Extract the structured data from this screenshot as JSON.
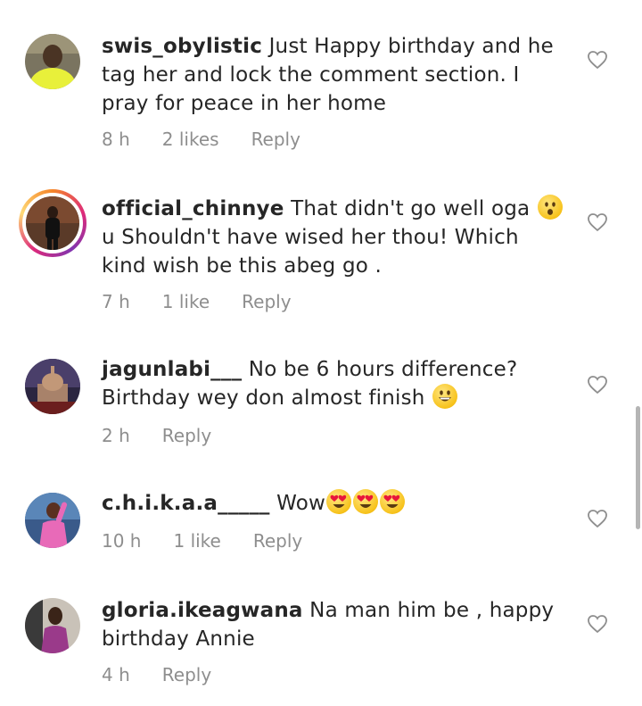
{
  "comments": [
    {
      "username": "swis_obylistic",
      "text": "Just Happy birthday and he tag her and lock the comment section. I pray for peace in her home",
      "time": "8 h",
      "likes": "2 likes",
      "reply": "Reply"
    },
    {
      "username": "official_chinnye",
      "text": "That didn't go well oga",
      "text2": "u Shouldn't have wised her thou! Which kind wish be this abeg go .",
      "time": "7 h",
      "likes": "1 like",
      "reply": "Reply"
    },
    {
      "username": "jagunlabi___",
      "text": "No be 6 hours difference? Birthday wey don almost finish",
      "time": "2 h",
      "reply": "Reply"
    },
    {
      "username": "c.h.i.k.a.a_____",
      "text": "Wow",
      "time": "10 h",
      "likes": "1 like",
      "reply": "Reply"
    },
    {
      "username": "gloria.ikeagwana",
      "text": "Na man him be , happy birthday Annie",
      "time": "4 h",
      "reply": "Reply"
    }
  ],
  "icons": [
    "heart-outline-icon",
    "avatar",
    "emoji"
  ]
}
